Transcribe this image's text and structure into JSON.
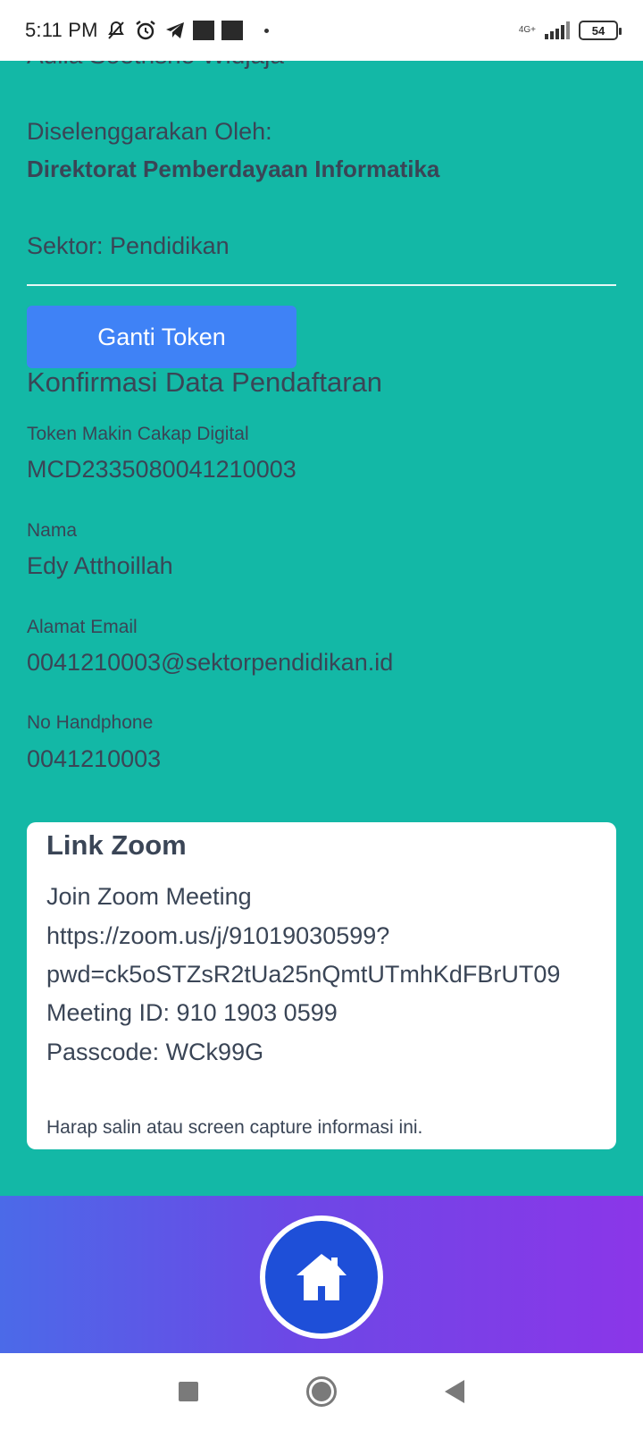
{
  "status_bar": {
    "time": "5:11 PM",
    "network_label": "4G+",
    "battery": "54",
    "icons": [
      "mute-icon",
      "alarm-icon",
      "telegram-icon",
      "notification-square-icon",
      "notification-square-icon",
      "more-dot-icon",
      "signal-icon",
      "battery-icon"
    ]
  },
  "event": {
    "cut_off_name": "Aulia Soetrisno Widjaja",
    "organizer_label": "Diselenggarakan Oleh:",
    "organizer": "Direktorat Pemberdayaan Informatika",
    "sector": "Sektor: Pendidikan"
  },
  "actions": {
    "change_token_label": "Ganti Token"
  },
  "confirmation": {
    "title": "Konfirmasi Data Pendaftaran",
    "fields": [
      {
        "label": "Token Makin Cakap Digital",
        "value": "MCD2335080041210003"
      },
      {
        "label": "Nama",
        "value": "Edy Atthoillah"
      },
      {
        "label": "Alamat Email",
        "value": "0041210003@sektorpendidikan.id"
      },
      {
        "label": "No Handphone",
        "value": "0041210003"
      }
    ]
  },
  "zoom": {
    "title": "Link Zoom",
    "lines": [
      "Join Zoom Meeting",
      "https://zoom.us/j/91019030599?",
      "pwd=ck5oSTZsR2tUa25nQmtUTmhKdFBrUT09",
      "Meeting ID: 910 1903 0599",
      "Passcode: WCk99G"
    ],
    "note": "Harap salin atau screen capture informasi ini."
  },
  "colors": {
    "content_bg": "#13b8a6",
    "button": "#3f82f6",
    "text": "#3a4556",
    "nav_gradient_start": "#4b6ae8",
    "nav_gradient_end": "#8b36e8",
    "home_button": "#1e4fd8"
  }
}
